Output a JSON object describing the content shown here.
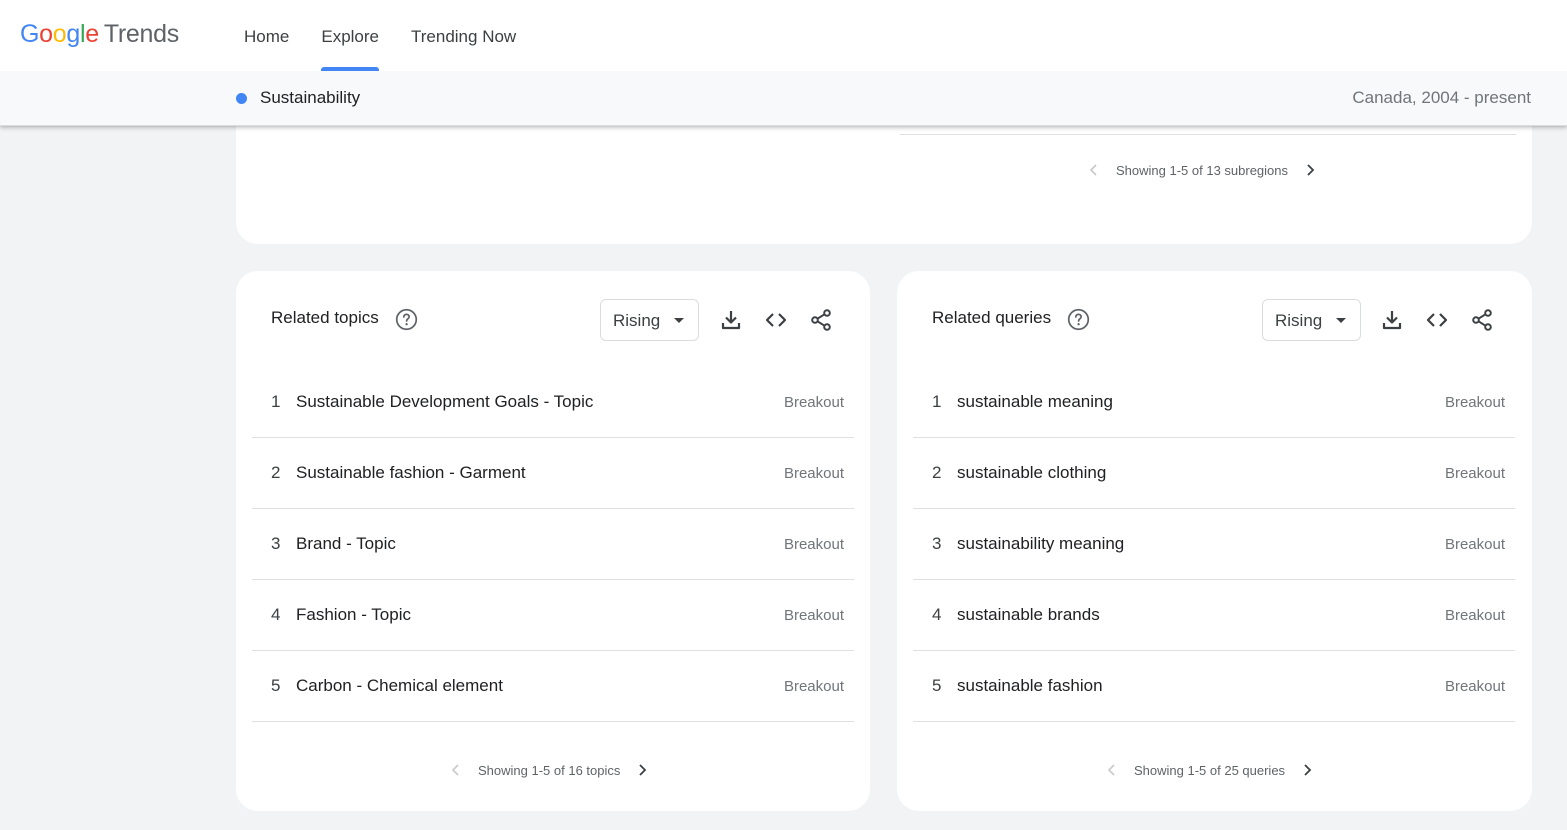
{
  "header": {
    "logo": {
      "letters": [
        "G",
        "o",
        "o",
        "g",
        "l",
        "e"
      ],
      "product": "Trends"
    },
    "nav": [
      {
        "label": "Home",
        "active": false
      },
      {
        "label": "Explore",
        "active": true
      },
      {
        "label": "Trending Now",
        "active": false
      }
    ]
  },
  "subheader": {
    "term": "Sustainability",
    "term_color": "#4285f4",
    "region_time": "Canada, 2004 - present"
  },
  "subregions": {
    "pager_text": "Showing 1-5 of 13 subregions"
  },
  "related_topics": {
    "title": "Related topics",
    "filter": "Rising",
    "pager_text": "Showing 1-5 of 16 topics",
    "rows": [
      {
        "rank": "1",
        "label": "Sustainable Development Goals - Topic",
        "value": "Breakout"
      },
      {
        "rank": "2",
        "label": "Sustainable fashion - Garment",
        "value": "Breakout"
      },
      {
        "rank": "3",
        "label": "Brand - Topic",
        "value": "Breakout"
      },
      {
        "rank": "4",
        "label": "Fashion - Topic",
        "value": "Breakout"
      },
      {
        "rank": "5",
        "label": "Carbon - Chemical element",
        "value": "Breakout"
      }
    ]
  },
  "related_queries": {
    "title": "Related queries",
    "filter": "Rising",
    "pager_text": "Showing 1-5 of 25 queries",
    "rows": [
      {
        "rank": "1",
        "label": "sustainable meaning",
        "value": "Breakout"
      },
      {
        "rank": "2",
        "label": "sustainable clothing",
        "value": "Breakout"
      },
      {
        "rank": "3",
        "label": "sustainability meaning",
        "value": "Breakout"
      },
      {
        "rank": "4",
        "label": "sustainable brands",
        "value": "Breakout"
      },
      {
        "rank": "5",
        "label": "sustainable fashion",
        "value": "Breakout"
      }
    ]
  },
  "colors": {
    "accent": "#4285f4",
    "page_background": "#f1f3f4",
    "muted_text": "#70757a"
  }
}
